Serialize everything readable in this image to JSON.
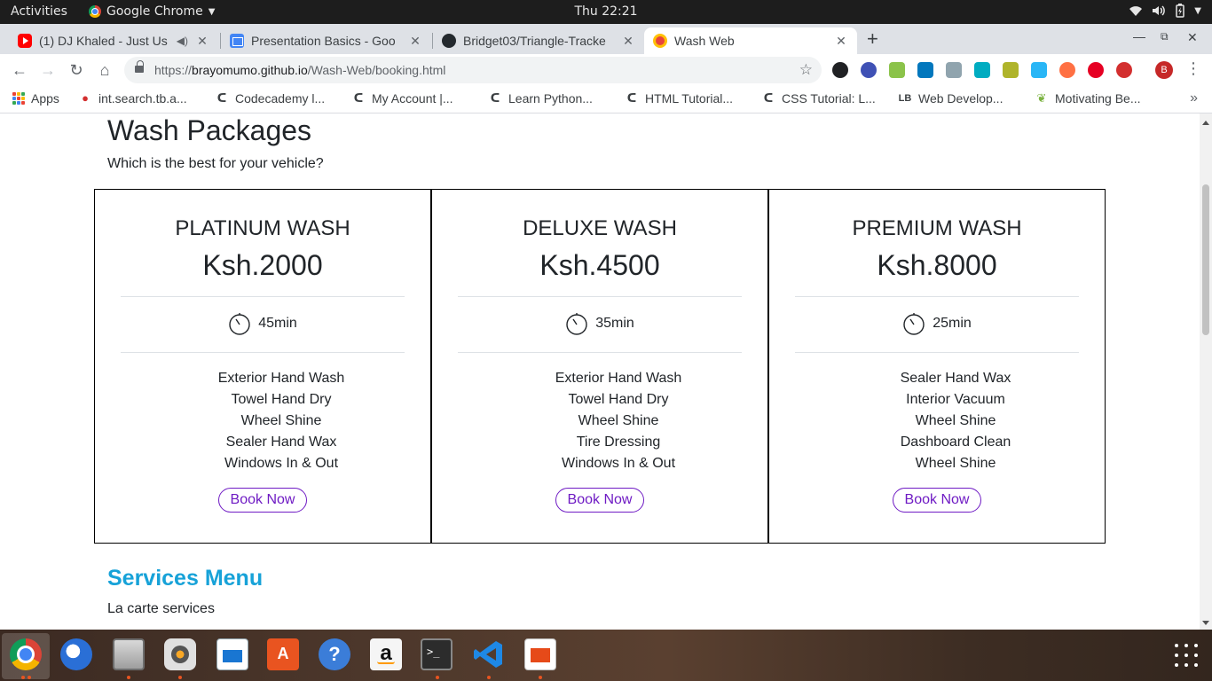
{
  "topbar": {
    "activities": "Activities",
    "app_name": "Google Chrome",
    "clock": "Thu 22:21"
  },
  "tabs": [
    {
      "title": "(1) DJ Khaled - Just Us",
      "icon": "youtube-icon"
    },
    {
      "title": "Presentation Basics - Goo",
      "icon": "slides-icon"
    },
    {
      "title": "Bridget03/Triangle-Tracke",
      "icon": "github-icon"
    },
    {
      "title": "Wash Web",
      "icon": "wash-web-icon"
    }
  ],
  "new_tab_label": "+",
  "url": {
    "prefix": "https://",
    "host": "brayomumo.github.io",
    "path": "/Wash-Web/booking.html"
  },
  "profile_initial": "B",
  "bookmarks": [
    {
      "label": "Apps",
      "icon": "apps-grid-icon"
    },
    {
      "label": "int.search.tb.a...",
      "icon": "ask-icon"
    },
    {
      "label": "Codecademy l...",
      "icon": "codecademy-icon"
    },
    {
      "label": "My Account |...",
      "icon": "codecademy-icon"
    },
    {
      "label": "Learn Python...",
      "icon": "codecademy-icon"
    },
    {
      "label": "HTML Tutorial...",
      "icon": "codecademy-icon"
    },
    {
      "label": "CSS Tutorial: L...",
      "icon": "codecademy-icon"
    },
    {
      "label": "Web Develop...",
      "icon": "lb-icon"
    },
    {
      "label": "Motivating Be...",
      "icon": "leaf-icon"
    }
  ],
  "page": {
    "packages_title": "Wash Packages",
    "packages_subtitle": "Which is the best for your vehicle?",
    "packages": [
      {
        "name": "PLATINUM WASH",
        "price": "Ksh.2000",
        "duration": "45min",
        "features": [
          "Exterior Hand Wash",
          "Towel Hand Dry",
          "Wheel Shine",
          "Sealer Hand Wax",
          "Windows In & Out"
        ],
        "button": "Book Now"
      },
      {
        "name": "DELUXE WASH",
        "price": "Ksh.4500",
        "duration": "35min",
        "features": [
          "Exterior Hand Wash",
          "Towel Hand Dry",
          "Wheel Shine",
          "Tire Dressing",
          "Windows In & Out"
        ],
        "button": "Book Now"
      },
      {
        "name": "PREMIUM WASH",
        "price": "Ksh.8000",
        "duration": "25min",
        "features": [
          "Sealer Hand Wax",
          "Interior Vacuum",
          "Wheel Shine",
          "Dashboard Clean",
          "Wheel Shine"
        ],
        "button": "Book Now"
      }
    ],
    "services_title": "Services Menu",
    "services_subtitle": "La carte services"
  },
  "colors": {
    "accent_link": "#17a2d8",
    "button_purple": "#6f1bc4",
    "topbar": "#1d1d1d",
    "tabstrip": "#dee1e6"
  },
  "dock": [
    {
      "name": "chrome-icon",
      "running": true
    },
    {
      "name": "thunderbird-icon",
      "running": false
    },
    {
      "name": "files-icon",
      "running": true
    },
    {
      "name": "rhythmbox-icon",
      "running": true
    },
    {
      "name": "writer-icon",
      "running": false
    },
    {
      "name": "software-center-icon",
      "running": false
    },
    {
      "name": "help-icon",
      "running": false
    },
    {
      "name": "amazon-icon",
      "running": false
    },
    {
      "name": "terminal-icon",
      "running": true
    },
    {
      "name": "vscode-icon",
      "running": true
    },
    {
      "name": "impress-icon",
      "running": true
    }
  ]
}
